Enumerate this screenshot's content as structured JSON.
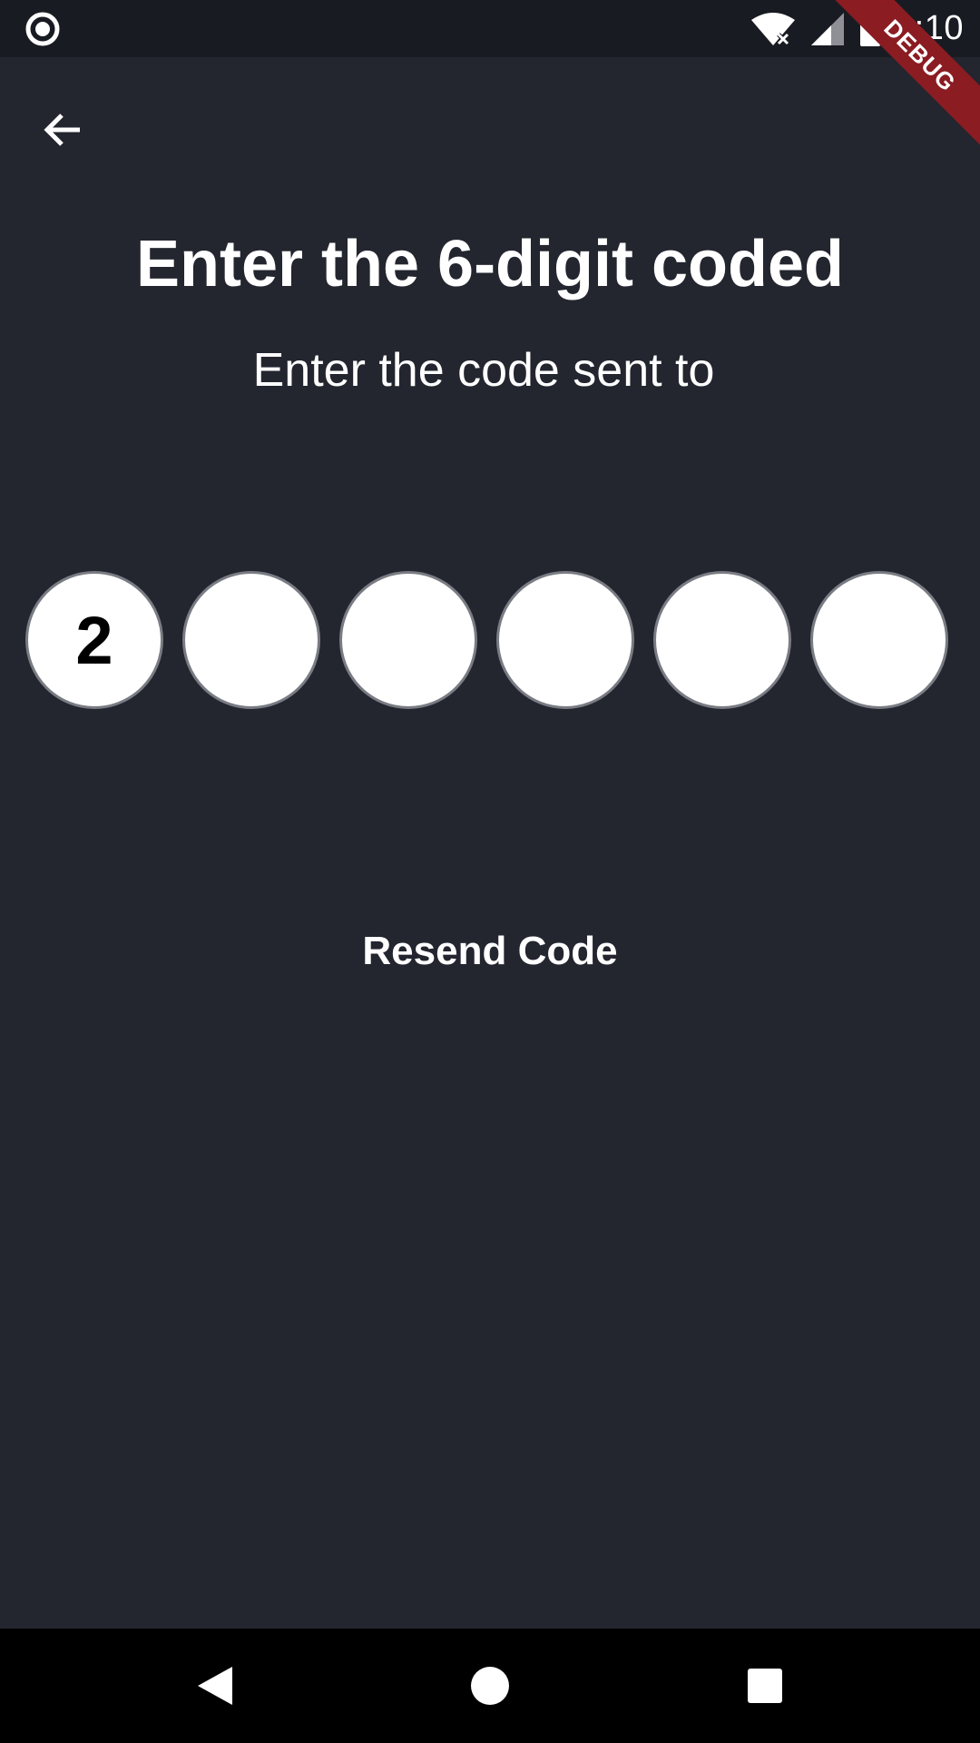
{
  "status_bar": {
    "time": "6:10"
  },
  "debug_banner": {
    "label": "DEBUG"
  },
  "header": {
    "title": "Enter the 6-digit coded",
    "subtitle": "Enter the code sent to"
  },
  "code_input": {
    "digits": [
      "2",
      "",
      "",
      "",
      "",
      ""
    ]
  },
  "actions": {
    "resend_label": "Resend Code"
  },
  "icons": {
    "status_left": "radio-record-icon",
    "wifi": "wifi-off-icon",
    "signal": "signal-icon",
    "battery": "battery-icon",
    "back": "arrow-back-icon",
    "nav_back": "triangle-back-icon",
    "nav_home": "circle-home-icon",
    "nav_recents": "square-recents-icon"
  },
  "colors": {
    "background": "#23252f",
    "status_bar": "#191b22",
    "circle_fill": "#ffffff",
    "circle_border": "#7a7c84",
    "debug_ribbon": "#8b1c22",
    "nav_bar": "#000000"
  }
}
